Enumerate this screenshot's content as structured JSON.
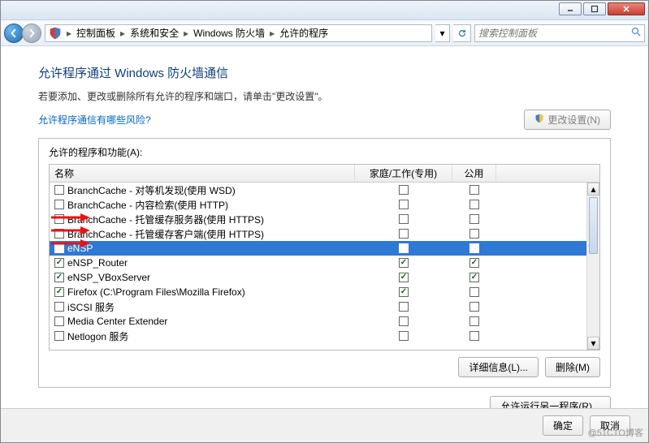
{
  "window_controls": {
    "min": "min",
    "max": "max",
    "close": "close"
  },
  "breadcrumb": {
    "items": [
      "控制面板",
      "系统和安全",
      "Windows 防火墙",
      "允许的程序"
    ]
  },
  "search": {
    "placeholder": "搜索控制面板"
  },
  "body": {
    "title": "允许程序通过 Windows 防火墙通信",
    "subtitle": "若要添加、更改或删除所有允许的程序和端口，请单击\"更改设置\"。",
    "risk_link": "允许程序通信有哪些风险?",
    "change_btn": "更改设置(N)"
  },
  "panel": {
    "label": "允许的程序和功能(A):",
    "columns": {
      "name": "名称",
      "home_work": "家庭/工作(专用)",
      "public": "公用"
    },
    "rows": [
      {
        "name": "BranchCache - 对等机发现(使用 WSD)",
        "checked": false,
        "c1": false,
        "c2": false,
        "sel": false
      },
      {
        "name": "BranchCache - 内容检索(使用 HTTP)",
        "checked": false,
        "c1": false,
        "c2": false,
        "sel": false
      },
      {
        "name": "BranchCache - 托管缓存服务器(使用 HTTPS)",
        "checked": false,
        "c1": false,
        "c2": false,
        "sel": false
      },
      {
        "name": "BranchCache - 托管缓存客户端(使用 HTTPS)",
        "checked": false,
        "c1": false,
        "c2": false,
        "sel": false
      },
      {
        "name": "eNSP",
        "checked": true,
        "c1": true,
        "c2": true,
        "sel": true
      },
      {
        "name": "eNSP_Router",
        "checked": true,
        "c1": true,
        "c2": true,
        "sel": false
      },
      {
        "name": "eNSP_VBoxServer",
        "checked": true,
        "c1": true,
        "c2": true,
        "sel": false
      },
      {
        "name": "Firefox (C:\\Program Files\\Mozilla Firefox)",
        "checked": true,
        "c1": true,
        "c2": false,
        "sel": false
      },
      {
        "name": "iSCSI 服务",
        "checked": false,
        "c1": false,
        "c2": false,
        "sel": false
      },
      {
        "name": "Media Center Extender",
        "checked": false,
        "c1": false,
        "c2": false,
        "sel": false
      },
      {
        "name": "Netlogon 服务",
        "checked": false,
        "c1": false,
        "c2": false,
        "sel": false
      }
    ],
    "details_btn": "详细信息(L)...",
    "delete_btn": "删除(M)"
  },
  "extra": {
    "allow_another": "允许运行另一程序(R)..."
  },
  "footer": {
    "ok": "确定",
    "cancel": "取消"
  },
  "watermark": "@51CTO博客"
}
